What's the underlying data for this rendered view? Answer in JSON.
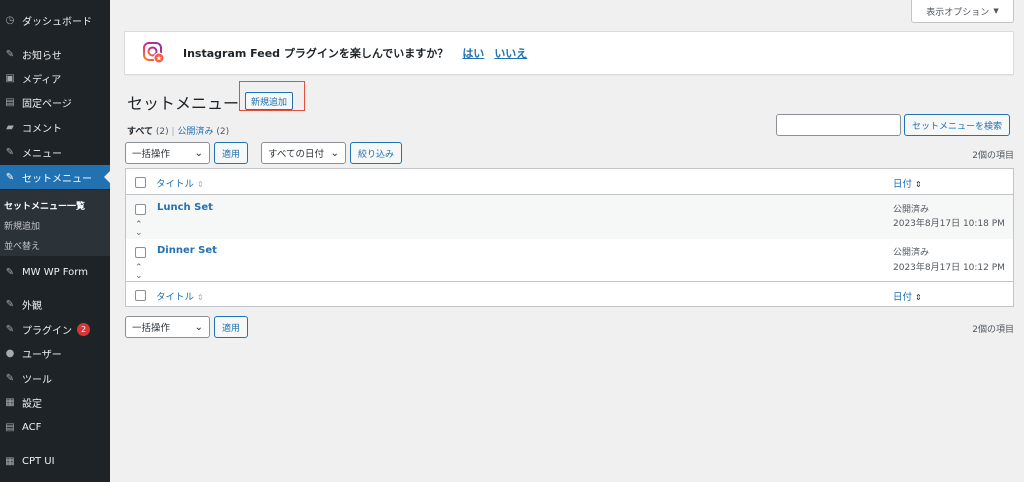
{
  "sidebar": {
    "items": [
      {
        "label": "ダッシュボード",
        "icon": "dashboard-icon",
        "glyph": "◷"
      },
      {
        "label": "お知らせ",
        "icon": "pin-icon",
        "glyph": "✎"
      },
      {
        "label": "メディア",
        "icon": "media-icon",
        "glyph": "▣"
      },
      {
        "label": "固定ページ",
        "icon": "page-icon",
        "glyph": "▤"
      },
      {
        "label": "コメント",
        "icon": "comment-icon",
        "glyph": "▰"
      },
      {
        "label": "メニュー",
        "icon": "pin-icon",
        "glyph": "✎"
      },
      {
        "label": "セットメニュー",
        "icon": "pin-icon",
        "glyph": "✎"
      },
      {
        "label": "MW WP Form",
        "icon": "pin-icon",
        "glyph": "✎"
      },
      {
        "label": "外観",
        "icon": "appearance-icon",
        "glyph": "✎"
      },
      {
        "label": "プラグイン",
        "icon": "plugin-icon",
        "glyph": "✎",
        "badge": "2"
      },
      {
        "label": "ユーザー",
        "icon": "user-icon",
        "glyph": "●"
      },
      {
        "label": "ツール",
        "icon": "wrench-icon",
        "glyph": "✎"
      },
      {
        "label": "設定",
        "icon": "settings-icon",
        "glyph": "▦"
      },
      {
        "label": "ACF",
        "icon": "acf-icon",
        "glyph": "▤"
      },
      {
        "label": "CPT UI",
        "icon": "cpt-icon",
        "glyph": "▦"
      }
    ],
    "submenu": [
      "セットメニュー一覧",
      "新規追加",
      "並べ替え"
    ]
  },
  "screen_options": {
    "label": "表示オプション",
    "arrow": "▼"
  },
  "notice": {
    "text": "Instagram Feed プラグインを楽しんでいますか？",
    "yes": "はい",
    "no": "いいえ"
  },
  "page": {
    "title": "セットメニュー",
    "add_new": "新規追加",
    "filters": {
      "all": "すべて",
      "all_count": "(2)",
      "sep": "|",
      "published": "公開済み",
      "published_count": "(2)"
    },
    "search_button": "セットメニューを検索",
    "bulk_action": "一括操作",
    "apply": "適用",
    "all_dates": "すべての日付",
    "filter_button": "絞り込み",
    "item_count": "2個の項目"
  },
  "table": {
    "col_title": "タイトル",
    "col_date": "日付",
    "rows": [
      {
        "title": "Lunch Set",
        "status": "公開済み",
        "date": "2023年8月17日 10:18 PM"
      },
      {
        "title": "Dinner Set",
        "status": "公開済み",
        "date": "2023年8月17日 10:12 PM"
      }
    ]
  },
  "colors": {
    "accent": "#2271b1",
    "sidebar_bg": "#1d2327",
    "badge": "#d63638",
    "highlight": "#e0503c"
  }
}
